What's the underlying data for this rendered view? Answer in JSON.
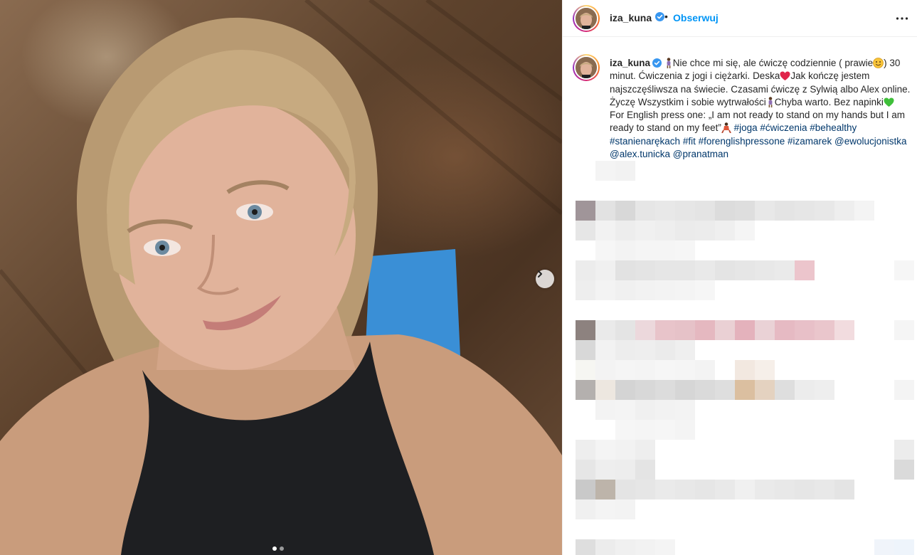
{
  "post": {
    "author": "iza_kuna",
    "follow_label": "Obserwuj",
    "separator": "•",
    "verified_icon": "verified-badge-icon",
    "more_icon": "more-options-icon",
    "next_icon": "chevron-right-icon"
  },
  "carousel": {
    "total": 2,
    "current": 1
  },
  "caption": {
    "author": "iza_kuna",
    "text1": "Nie chce mi się, ale ćwiczę codziennie ( prawie",
    "text2": ") 30 minut. Ćwiczenia z jogi i ciężarki. Deska",
    "text3": "Jak kończę jestem najszczęśliwsza na świecie. Czasami ćwiczę z Sylwią albo Alex online. Życzę Wszystkim i sobie wytrwałości",
    "text4": "Chyba warto. Bez napinki",
    "text5": "For English press one: „I am not ready to stand on my hands but I am ready to stand on my feet”",
    "hashtags": [
      "#joga",
      "#ćwiczenia",
      "#behealthy",
      "#stanienarękach",
      "#fit",
      "#forenglishpressone",
      "#izamarek"
    ],
    "mentions": [
      "@ewolucjonistka",
      "@alex.tunicka",
      "@pranatman"
    ]
  },
  "colors": {
    "accent": "#0095f6",
    "link": "#00376b",
    "text": "#262626",
    "divider": "#efefef"
  }
}
